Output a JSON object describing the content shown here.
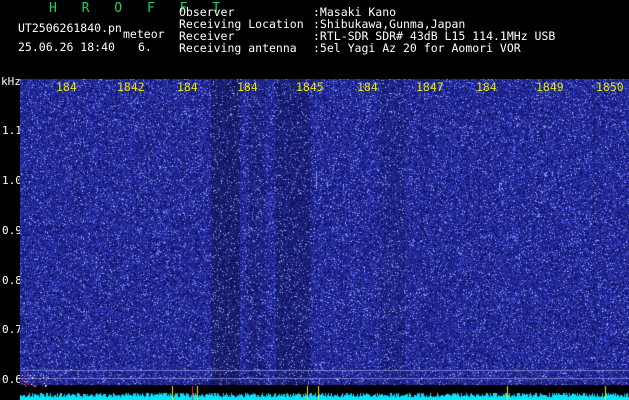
{
  "header": {
    "program": "H R O F F T",
    "filename": "UT2506261840.pn",
    "tag": "meteor",
    "datetime": "25.06.26 18:40",
    "count": "6.",
    "info": [
      {
        "key": "Observer",
        "value": ":Masaki Kano"
      },
      {
        "key": "Receiving Location",
        "value": ":Shibukawa,Gunma,Japan"
      },
      {
        "key": "Receiver",
        "value": ":RTL-SDR SDR# 43dB L15 114.1MHz USB"
      },
      {
        "key": "Receiving antenna",
        "value": ":5el Yagi Az 20 for Aomori VOR"
      }
    ]
  },
  "axis": {
    "y_unit": "kHz",
    "y_ticks": [
      "1.1",
      "1.0",
      "0.9",
      "0.8",
      "0.7",
      "0.6"
    ],
    "x_ticks": [
      "184",
      "1842",
      "184",
      "184",
      "1845",
      "184",
      "1847",
      "184",
      "1849",
      "1850"
    ]
  },
  "colors": {
    "background": "#000000",
    "title_green": "#19d45a",
    "tick_yellow": "#e8e800",
    "spectrogram_base": "#1a1e84",
    "baseline_cyan": "#00e6ff"
  }
}
